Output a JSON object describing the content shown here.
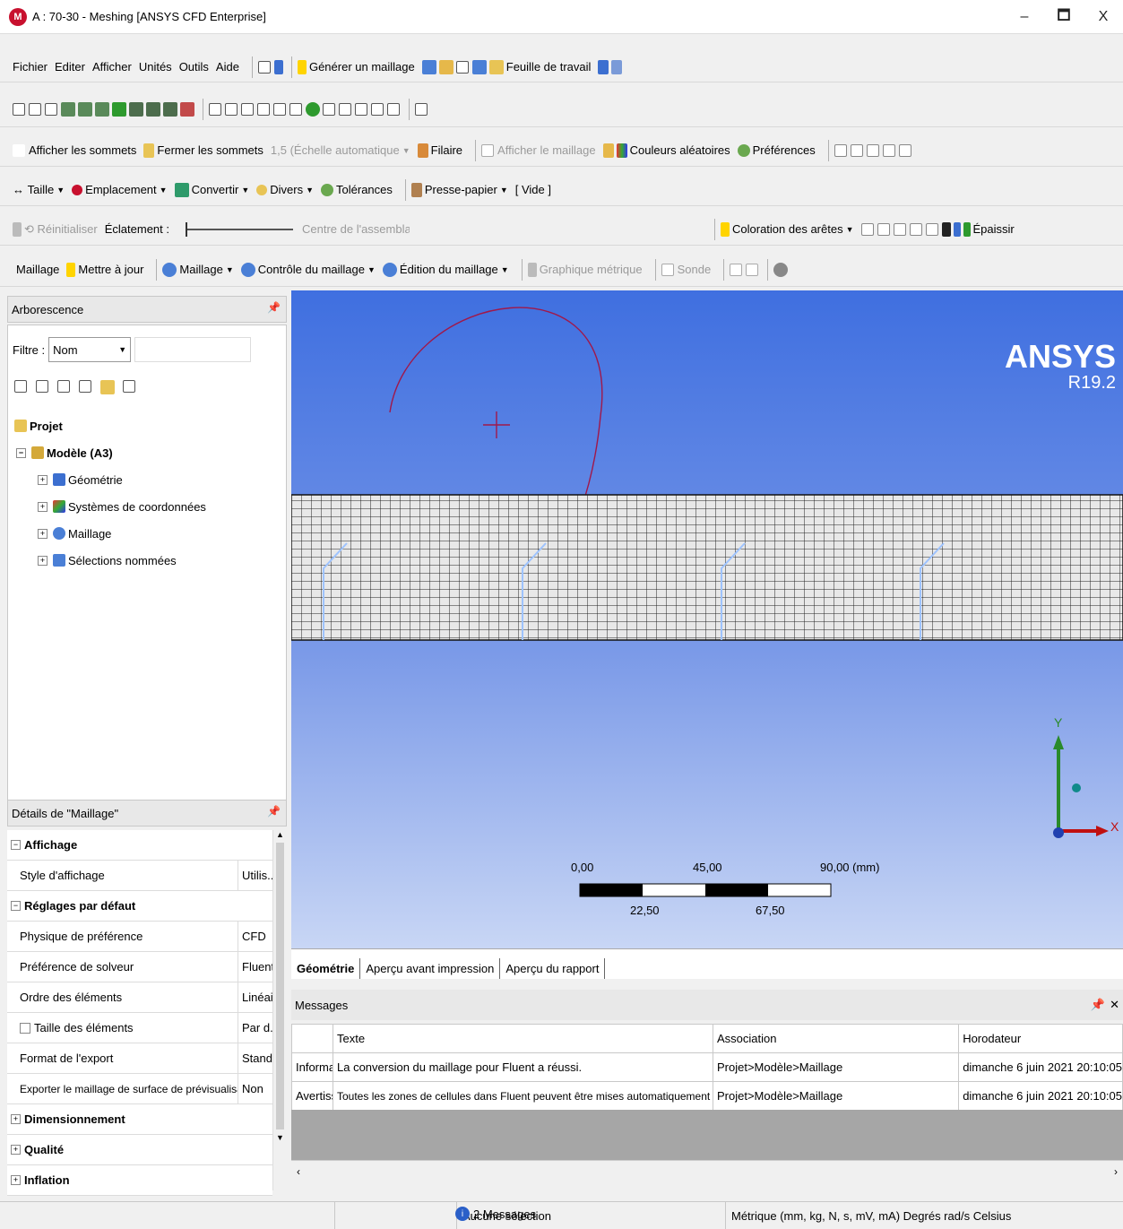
{
  "window": {
    "title": "A : 70-30 - Meshing [ANSYS CFD Enterprise]",
    "logo": "M",
    "min": "–",
    "max": "🗖",
    "close": "X"
  },
  "menu": {
    "items": [
      "Fichier",
      "Editer",
      "Afficher",
      "Unités",
      "Outils",
      "Aide"
    ],
    "generate_mesh": "Générer un maillage",
    "worksheet": "Feuille de travail"
  },
  "toolbar3": {
    "show_vertices": "Afficher les sommets",
    "close_vertices": "Fermer les sommets",
    "scale": "1,5 (Échelle automatique",
    "wireframe": "Filaire",
    "show_mesh": "Afficher le maillage",
    "random_colors": "Couleurs aléatoires",
    "preferences": "Préférences"
  },
  "toolbar4": {
    "size": "Taille",
    "location": "Emplacement",
    "convert": "Convertir",
    "misc": "Divers",
    "tolerances": "Tolérances",
    "clipboard": "Presse-papier",
    "empty": "[ Vide ]"
  },
  "toolbar5": {
    "reset": "Réinitialiser",
    "explode": "Éclatement :",
    "assembly_center": "Centre de l'assemblage",
    "edge_coloring": "Coloration des arêtes",
    "thicken": "Épaissir"
  },
  "toolbar6": {
    "mesh": "Maillage",
    "update": "Mettre à jour",
    "mesh_menu": "Maillage",
    "mesh_control": "Contrôle du maillage",
    "mesh_edit": "Édition du maillage",
    "metric_graph": "Graphique métrique",
    "probe": "Sonde"
  },
  "outline": {
    "title": "Arborescence",
    "filter_label": "Filtre :",
    "filter_value": "Nom",
    "project": "Projet",
    "model": "Modèle (A3)",
    "children": [
      "Géométrie",
      "Systèmes de coordonnées",
      "Maillage",
      "Sélections nommées"
    ]
  },
  "details": {
    "title": "Détails de \"Maillage\"",
    "groups": [
      {
        "name": "Affichage",
        "rows": [
          {
            "k": "Style d'affichage",
            "v": "Utilis..."
          }
        ]
      },
      {
        "name": "Réglages par défaut",
        "rows": [
          {
            "k": "Physique de préférence",
            "v": "CFD"
          },
          {
            "k": "Préférence de solveur",
            "v": "Fluent"
          },
          {
            "k": "Ordre des éléments",
            "v": "Linéai..."
          },
          {
            "k": "Taille des éléments",
            "v": "Par d..."
          },
          {
            "k": "Format de l'export",
            "v": "Stand..."
          },
          {
            "k": "Exporter le maillage de surface de prévisualisation",
            "v": "Non"
          }
        ]
      }
    ],
    "collapsed": [
      "Dimensionnement",
      "Qualité",
      "Inflation"
    ]
  },
  "viewport": {
    "brand": "ANSYS",
    "version": "R19.2",
    "scale_top": [
      "0,00",
      "45,00",
      "90,00 (mm)"
    ],
    "scale_bottom": [
      "22,50",
      "67,50"
    ],
    "axis_x": "X",
    "axis_y": "Y"
  },
  "tabs": [
    "Géométrie",
    "Aperçu avant impression",
    "Aperçu du rapport"
  ],
  "messages": {
    "title": "Messages",
    "headers": [
      "",
      "Texte",
      "Association",
      "Horodateur"
    ],
    "rows": [
      [
        "Informa",
        "La conversion du maillage pour Fluent a réussi.",
        "Projet>Modèle>Maillage",
        "dimanche 6 juin 2021 20:10:05"
      ],
      [
        "Avertiss",
        "Toutes les zones de cellules dans Fluent peuvent être mises automatiquement à Fluid.",
        "Projet>Modèle>Maillage",
        "dimanche 6 juin 2021 20:10:05"
      ]
    ]
  },
  "status": {
    "messages": "2 Messages",
    "selection": "Aucune sélection",
    "units": "Métrique (mm, kg, N, s, mV, mA)  Degrés  rad/s  Celsius"
  },
  "colors": {
    "viewport_top": "#3f6fe0",
    "mesh": "#3a3a3a",
    "accent": "#ffd400"
  }
}
